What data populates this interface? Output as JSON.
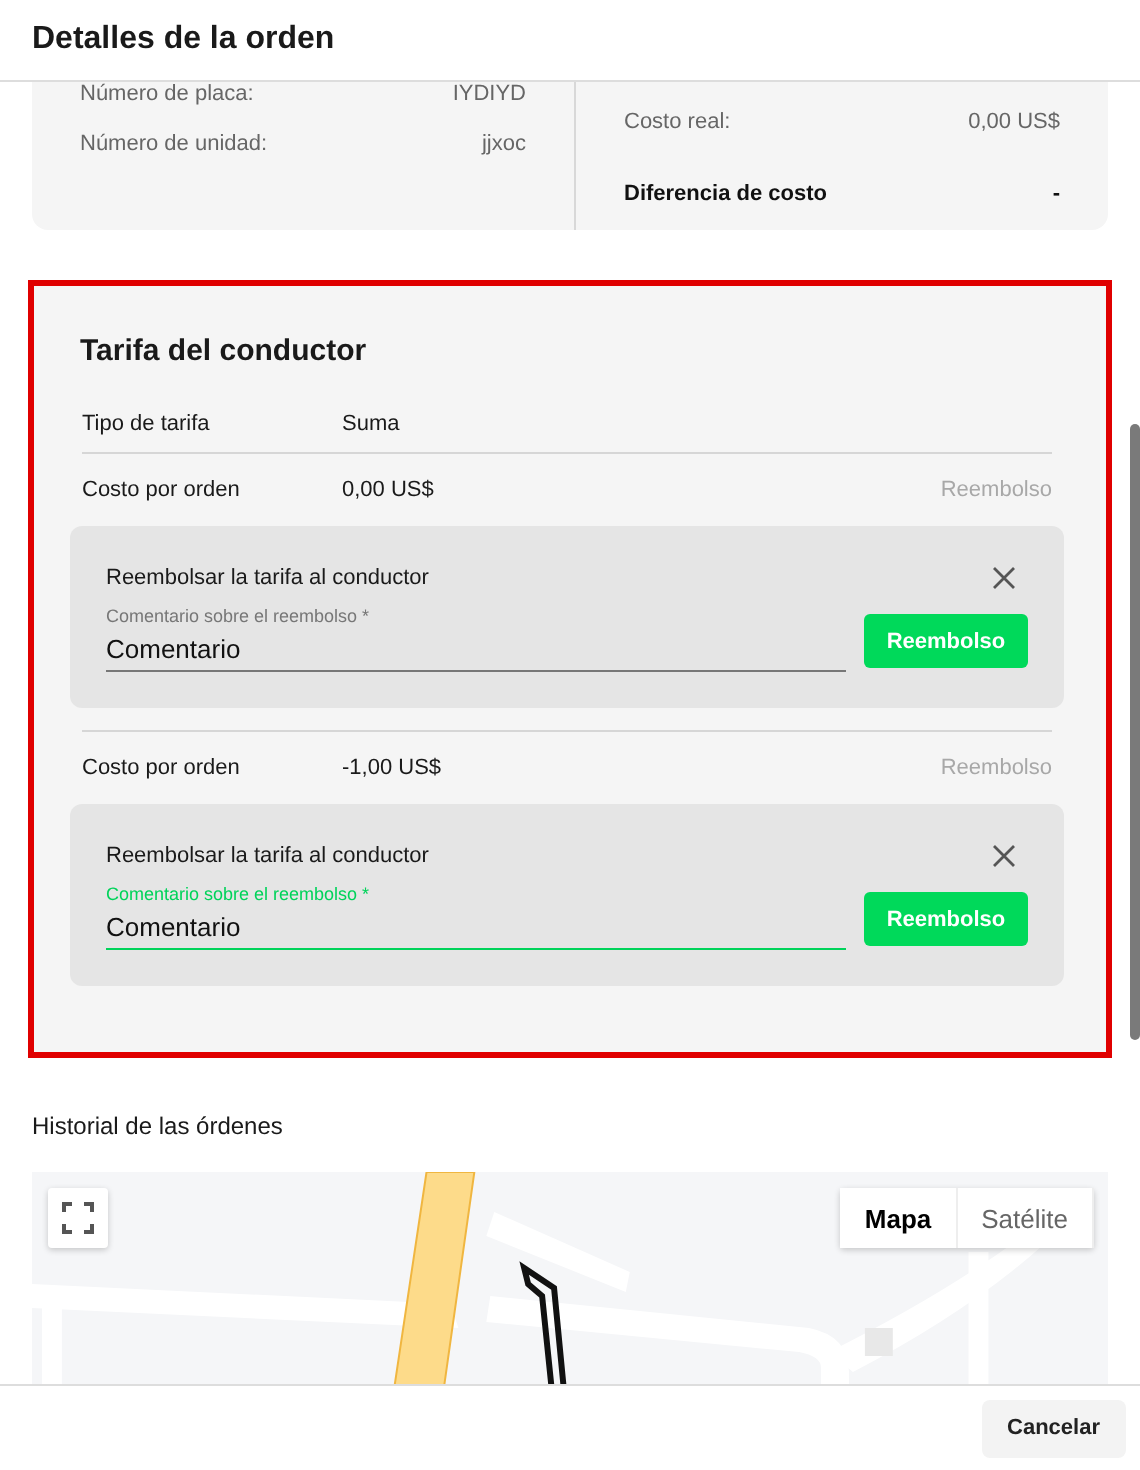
{
  "window": {
    "title": "Detalles de la orden"
  },
  "summary": {
    "left": [
      {
        "label": "Número de placa:",
        "value": "IYDIYD"
      },
      {
        "label": "Número de unidad:",
        "value": "jjxoc"
      }
    ],
    "right": [
      {
        "label": "Costo real:",
        "value": "0,00 US$",
        "bold": false
      },
      {
        "label": "Diferencia de costo",
        "value": "-",
        "bold": true
      }
    ]
  },
  "driver_fee": {
    "title": "Tarifa del conductor",
    "header": {
      "label": "Tipo de tarifa",
      "value": "Suma"
    },
    "items": [
      {
        "label": "Costo por orden",
        "value": "0,00 US$",
        "link": {
          "label": "Reembolso",
          "disabled": true
        },
        "panel": {
          "title": "Reembolsar la tarifa al conductor",
          "field": {
            "label": "Comentario sobre el reembolso *",
            "value": "Comentario",
            "focused": false
          },
          "button": "Reembolso"
        }
      },
      {
        "label": "Costo por orden",
        "value": "-1,00 US$",
        "link": {
          "label": "Reembolso",
          "disabled": true
        },
        "panel": {
          "title": "Reembolsar la tarifa al conductor",
          "field": {
            "label": "Comentario sobre el reembolso *",
            "value": "Comentario",
            "focused": true
          },
          "button": "Reembolso"
        }
      }
    ]
  },
  "history": {
    "title": "Historial de las órdenes",
    "map": {
      "kind": "picture",
      "types": [
        {
          "label": "Mapa",
          "selected": true
        },
        {
          "label": "Satélite",
          "selected": false
        }
      ]
    }
  },
  "footer": {
    "buttons": [
      "Cancelar"
    ]
  }
}
